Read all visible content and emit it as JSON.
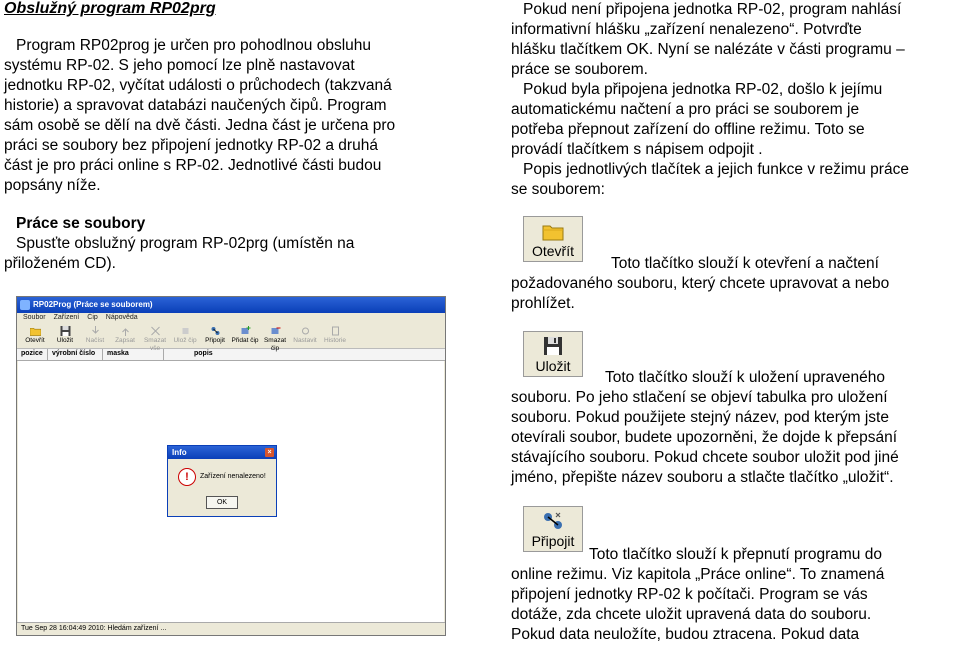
{
  "left": {
    "title": "Obslužný program RP02prg",
    "intro_lines": [
      "Program RP02prog je určen pro pohodlnou obsluhu",
      "systému RP-02. S jeho pomocí lze plně nastavovat",
      "jednotku RP-02, vyčítat události o průchodech (takzvaná",
      "historie) a spravovat databázi naučených čipů. Program",
      "sám osobě se dělí na dvě části. Jedna část je určena pro",
      "práci se soubory bez připojení jednotky RP-02 a druhá",
      "část je pro práci online s RP-02. Jednotlivé části budou",
      "popsány níže."
    ],
    "section_heading": "Práce se soubory",
    "section_lines": [
      "Spusťte obslužný program RP-02prg (umístěn na",
      "přiloženém CD)."
    ]
  },
  "screenshot": {
    "window_title": "RP02Prog (Práce se souborem)",
    "menu": [
      "Soubor",
      "Zařízení",
      "Čip",
      "Nápověda"
    ],
    "toolbar": [
      {
        "label": "Otevřít",
        "icon": "folder-icon",
        "enabled": true
      },
      {
        "label": "Uložit",
        "icon": "floppy-icon",
        "enabled": true
      },
      {
        "label": "Načíst",
        "icon": "download-icon",
        "enabled": false
      },
      {
        "label": "Zapsat",
        "icon": "upload-icon",
        "enabled": false
      },
      {
        "label": "Smazat vše",
        "icon": "delete-all-icon",
        "enabled": false
      },
      {
        "label": "Ulož čip",
        "icon": "chip-icon",
        "enabled": false
      },
      {
        "label": "Připojit",
        "icon": "connect-icon",
        "enabled": true
      },
      {
        "label": "Přidat čip",
        "icon": "add-chip-icon",
        "enabled": true
      },
      {
        "label": "Smazat čip",
        "icon": "remove-chip-icon",
        "enabled": true
      },
      {
        "label": "Nastavit",
        "icon": "settings-icon",
        "enabled": false
      },
      {
        "label": "Historie",
        "icon": "history-icon",
        "enabled": false
      }
    ],
    "columns": [
      "pozice",
      "výrobní číslo",
      "maska",
      "popis"
    ],
    "dialog": {
      "title": "Info",
      "message": "Zařízení nenalezeno!",
      "ok_label": "OK"
    },
    "status": "Tue Sep 28 16:04:49 2010: Hledám zařízení ..."
  },
  "right": {
    "p1_lines": [
      "Pokud není připojena jednotka RP-02, program nahlásí",
      "informativní hlášku „zařízení nenalezeno“. Potvrďte",
      "hlášku tlačítkem OK. Nyní se nalézáte v části programu –",
      "práce se souborem."
    ],
    "p2_lines": [
      "Pokud byla připojena jednotka RP-02, došlo k jejímu",
      "automatickému načtení a pro práci se souborem je",
      "potřeba přepnout zařízení do offline režimu. Toto se",
      "provádí tlačítkem s nápisem odpojit ."
    ],
    "p3_lines": [
      "Popis jednotlivých tlačítek a jejich funkce v režimu práce",
      "se souborem:"
    ],
    "btn_open": {
      "label": "Otevřít",
      "icon": "folder-icon"
    },
    "open_lines": [
      "Toto tlačítko slouží k otevření a načtení",
      "požadovaného souboru, který chcete upravovat a nebo",
      "prohlížet."
    ],
    "btn_save": {
      "label": "Uložit",
      "icon": "floppy-icon"
    },
    "save_lines": [
      "Toto tlačítko slouží k uložení upraveného",
      "souboru. Po jeho stlačení se objeví tabulka pro uložení",
      "souboru. Pokud použijete stejný název, pod kterým jste",
      "otevírali soubor, budete upozorněni, že dojde k přepsání",
      "stávajícího souboru. Pokud chcete soubor uložit pod jiné",
      "jméno, přepište název souboru a stlačte tlačítko „uložit“."
    ],
    "btn_connect": {
      "label": "Připojit",
      "icon": "connect-icon"
    },
    "connect_lines": [
      "Toto tlačítko slouží k přepnutí programu do",
      "online režimu. Viz kapitola „Práce online“. To znamená",
      "připojení jednotky RP-02 k počítači. Program se vás",
      "dotáže, zda chcete uložit upravená data do souboru.",
      "Pokud data neuložíte, budou ztracena. Pokud data"
    ]
  }
}
